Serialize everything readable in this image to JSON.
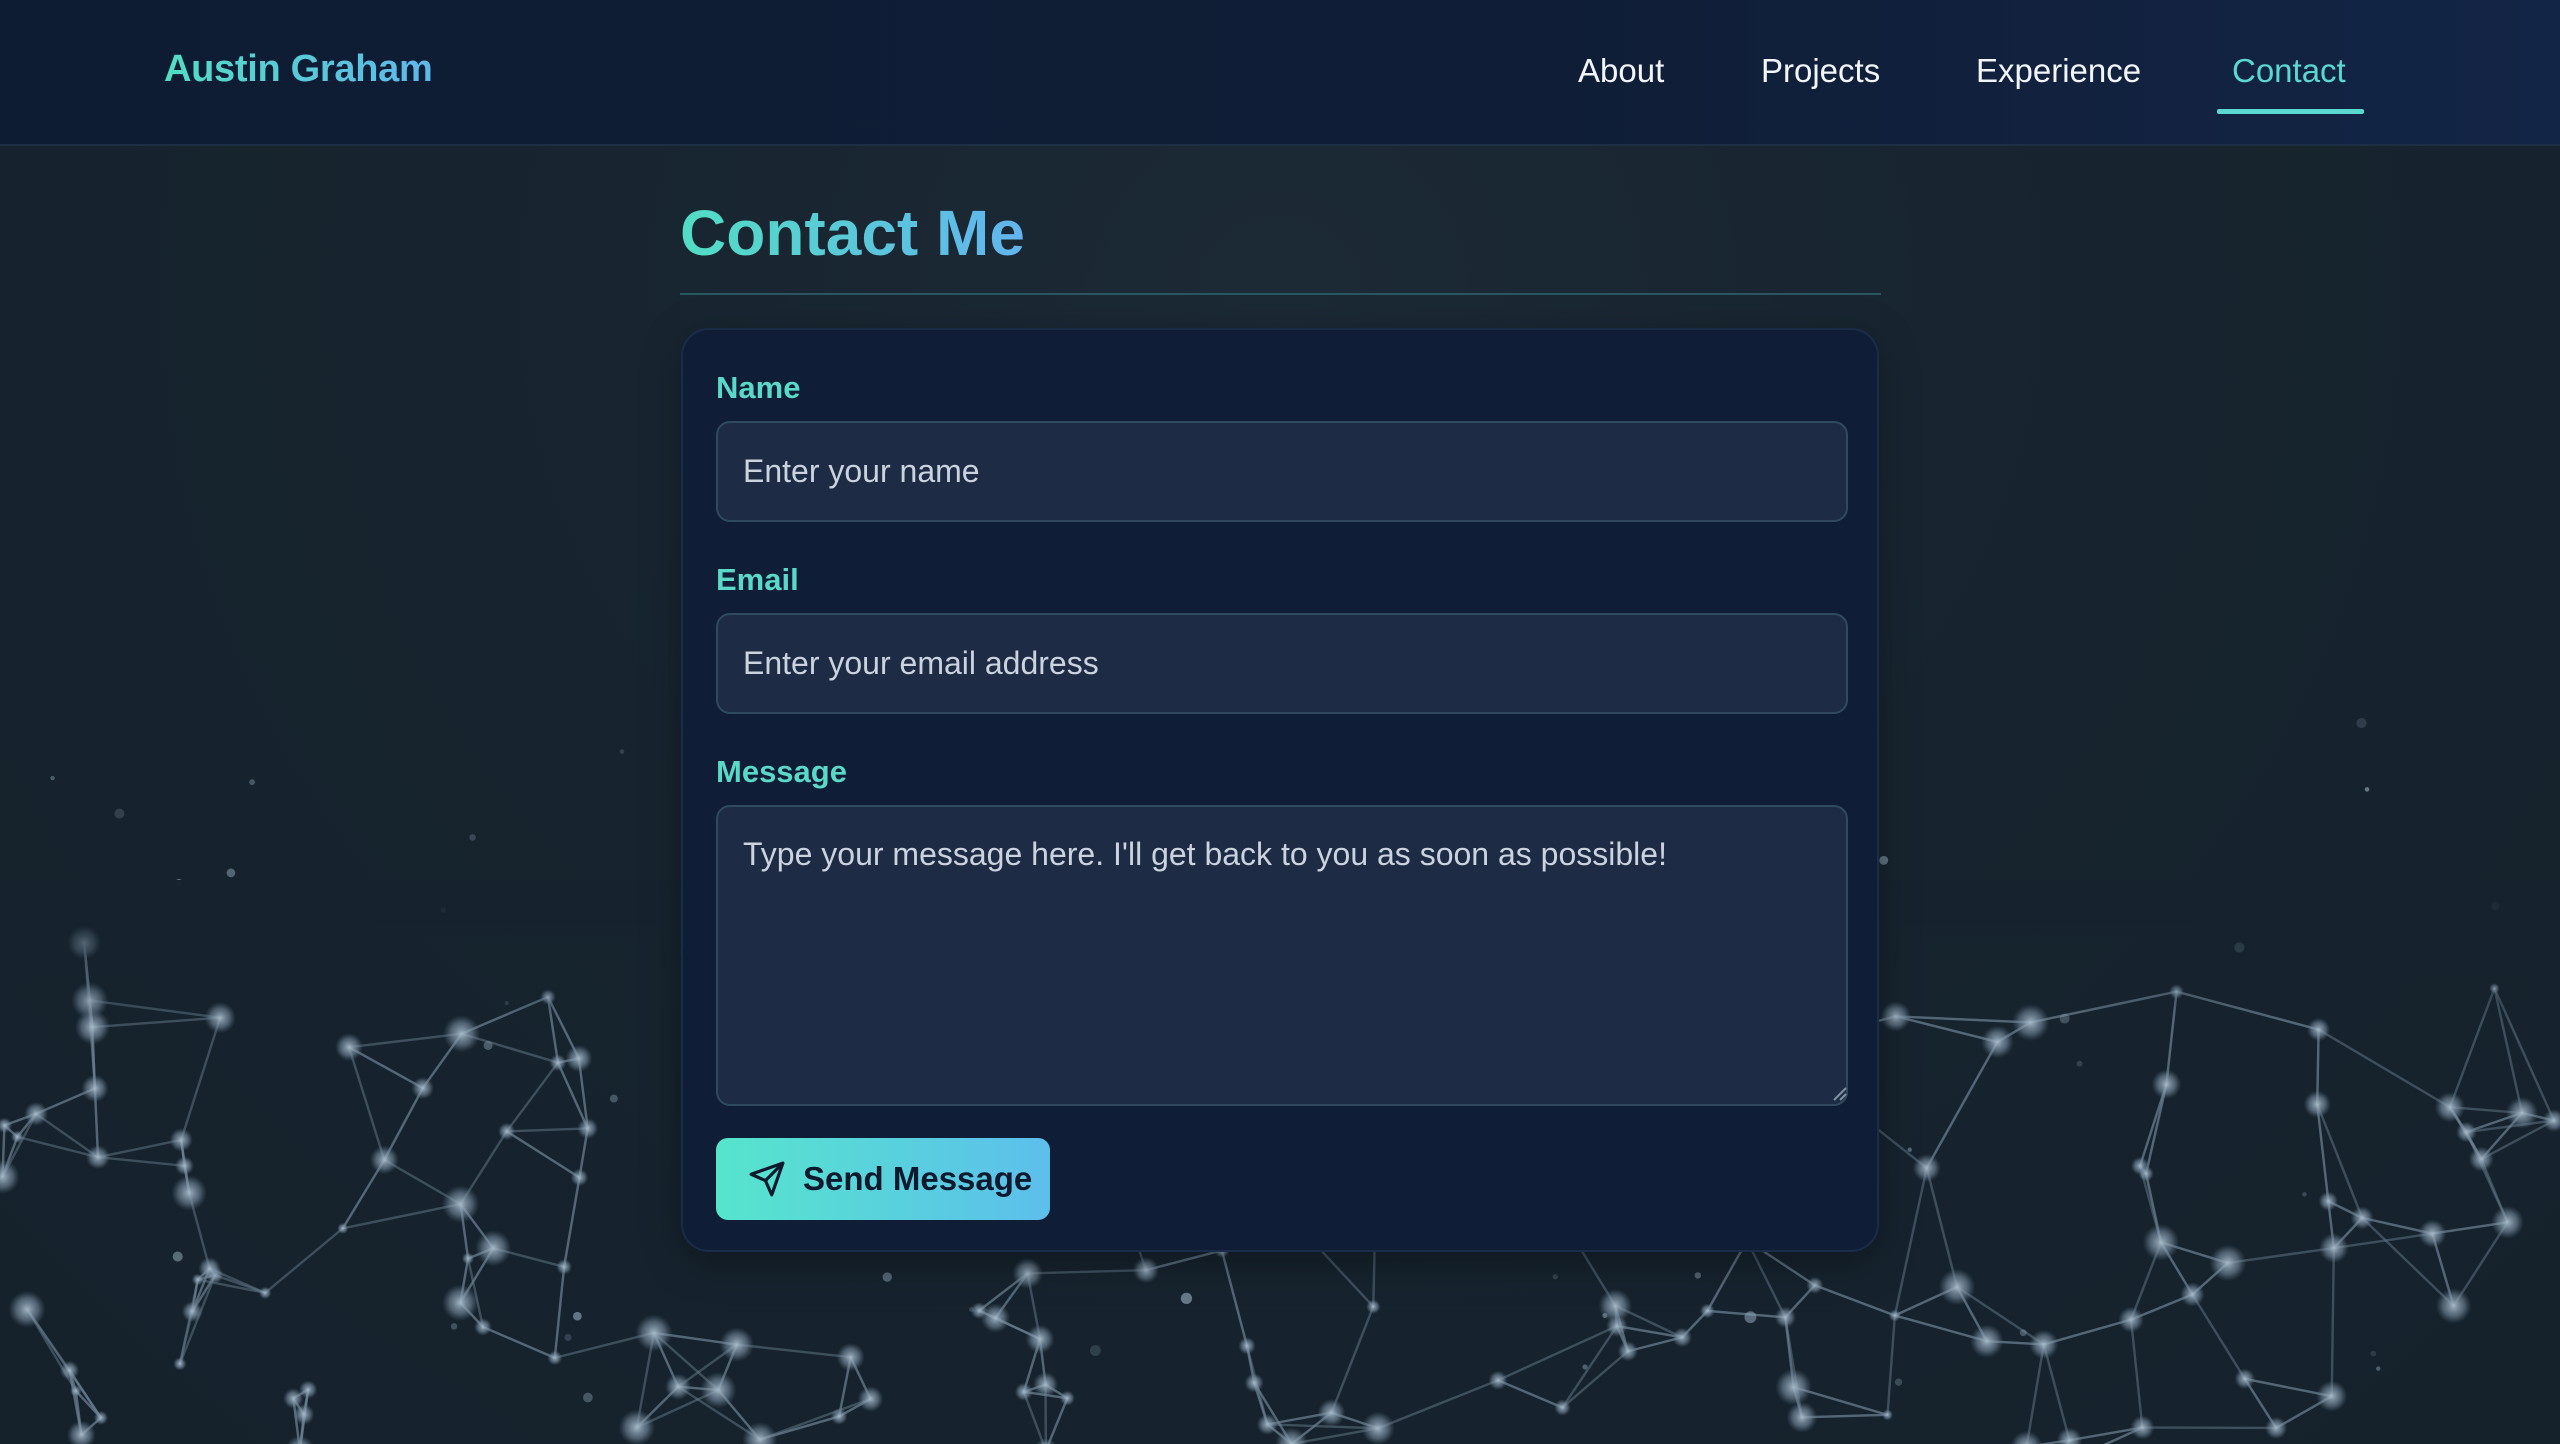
{
  "header": {
    "brand": "Austin Graham",
    "nav": [
      {
        "label": "About"
      },
      {
        "label": "Projects"
      },
      {
        "label": "Experience"
      },
      {
        "label": "Contact",
        "active": true
      }
    ]
  },
  "main": {
    "title": "Contact Me",
    "form": {
      "name_label": "Name",
      "name_placeholder": "Enter your name",
      "email_label": "Email",
      "email_placeholder": "Enter your email address",
      "message_label": "Message",
      "message_placeholder": "Type your message here. I'll get back to you as soon as possible!",
      "submit_label": "Send Message"
    }
  },
  "icons": {
    "send": "paper-plane-icon"
  },
  "colors": {
    "accent_teal": "#5ad8c8",
    "accent_blue": "#5fb7ec",
    "nav_bg": "#0f1d36",
    "card_bg": "#0f1d36",
    "input_bg": "#1d2b44"
  }
}
